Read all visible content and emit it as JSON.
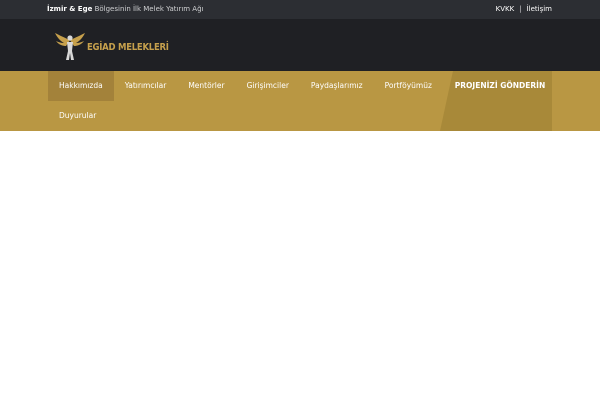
{
  "topbar": {
    "tagline_bold": "İzmir & Ege",
    "tagline_rest": " Bölgesinin İlk Melek Yatırım Ağı",
    "links": [
      {
        "label": "KVKK"
      },
      {
        "label": "İletişim"
      }
    ],
    "separator": "|"
  },
  "header": {
    "logo_text": "EGİAD MELEKLERİ",
    "logo_icon": "winged-figure-icon",
    "colors": {
      "gold": "#c6a04c",
      "dark": "#1f2024"
    }
  },
  "nav": {
    "items": [
      {
        "label": "Hakkımızda",
        "active": true
      },
      {
        "label": "Yatırımcılar"
      },
      {
        "label": "Mentörler"
      },
      {
        "label": "Girişimciler"
      },
      {
        "label": "Paydaşlarımız"
      },
      {
        "label": "Portföyümüz"
      }
    ],
    "second_row": [
      {
        "label": "Duyurular"
      }
    ],
    "cta_label": "PROJENİZİ GÖNDERİN",
    "colors": {
      "bar": "#b99743",
      "active": "#a3823a",
      "cta": "#a88939"
    }
  }
}
